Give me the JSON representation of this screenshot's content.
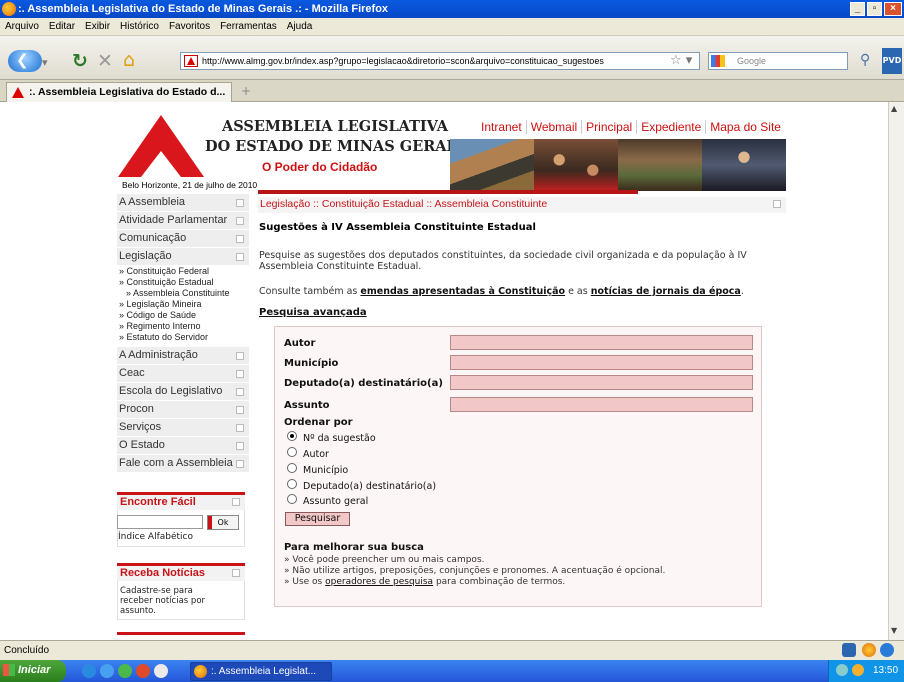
{
  "window": {
    "title": ":. Assembleia Legislativa do Estado de Minas Gerais .: - Mozilla Firefox"
  },
  "menu": [
    "Arquivo",
    "Editar",
    "Exibir",
    "Histórico",
    "Favoritos",
    "Ferramentas",
    "Ajuda"
  ],
  "toolbar": {
    "url": "http://www.almg.gov.br/index.asp?grupo=legislacao&diretorio=scon&arquivo=constituicao_sugestoes",
    "search_placeholder": "Google",
    "pvd_label": "PVD"
  },
  "tab": {
    "label": ":. Assembleia Legislativa do Estado d...",
    "new_tab": "+"
  },
  "header": {
    "title_line1": "ASSEMBLEIA LEGISLATIVA",
    "title_line2": "DO ESTADO DE MINAS GERAIS",
    "slogan": "O Poder do Cidadão",
    "date": "Belo Horizonte, 21 de julho de 2010",
    "topnav": [
      "Intranet",
      "Webmail",
      "Principal",
      "Expediente",
      "Mapa do Site"
    ]
  },
  "sidebar": {
    "items": [
      "A Assembleia",
      "Atividade Parlamentar",
      "Comunicação",
      "Legislação",
      "A Administração",
      "Ceac",
      "Escola do Legislativo",
      "Procon",
      "Serviços",
      "O Estado",
      "Fale com a Assembleia"
    ],
    "legislacao_sub": [
      "» Constituição Federal",
      "» Constituição Estadual",
      "» Assembleia Constituinte",
      "» Legislação Mineira",
      "» Código de Saúde",
      "» Regimento Interno",
      "» Estatuto do Servidor"
    ],
    "encontre": {
      "title": "Encontre Fácil",
      "ok": "Ok",
      "index": "Índice Alfabético"
    },
    "receba": {
      "title": "Receba Notícias",
      "text_l1": "Cadastre-se para",
      "text_l2": "receber notícias por",
      "text_l3": "assunto."
    }
  },
  "main": {
    "breadcrumb": "Legislação :: Constituição Estadual :: Assembleia Constituinte",
    "title": "Sugestões à IV Assembleia Constituinte Estadual",
    "intro_l1": "Pesquise as sugestões dos deputados constituintes, da sociedade civil organizada e da população à IV",
    "intro_l2": "Assembleia Constituinte Estadual.",
    "see_also_prefix": "Consulte também as",
    "see_also_link1": "emendas apresentadas à Constituição",
    "see_also_mid": "e as",
    "see_also_link2": "notícias de jornais da época",
    "see_also_suffix": ".",
    "advanced": "Pesquisa avançada",
    "form": {
      "fields": [
        "Autor",
        "Município",
        "Deputado(a) destinatário(a)",
        "Assunto"
      ],
      "order_title": "Ordenar por",
      "order_options": [
        "Nº da sugestão",
        "Autor",
        "Município",
        "Deputado(a) destinatário(a)",
        "Assunto geral"
      ],
      "selected_index": 0,
      "submit": "Pesquisar",
      "tips_title": "Para melhorar sua busca",
      "tip1": "» Você pode preencher um ou mais campos.",
      "tip2": "» Não utilize artigos, preposições, conjunções e pronomes. A acentuação é opcional.",
      "tip3_prefix": "» Use os",
      "tip3_link": "operadores de pesquisa",
      "tip3_suffix": "para combinação de termos."
    }
  },
  "status": {
    "text": "Concluído"
  },
  "taskbar": {
    "start": "Iniciar",
    "task": ":. Assembleia Legislat...",
    "clock": "13:50"
  },
  "colors": {
    "brand_red": "#c81418",
    "input_pink": "#f1c7c7",
    "xp_blue": "#2456d8"
  }
}
